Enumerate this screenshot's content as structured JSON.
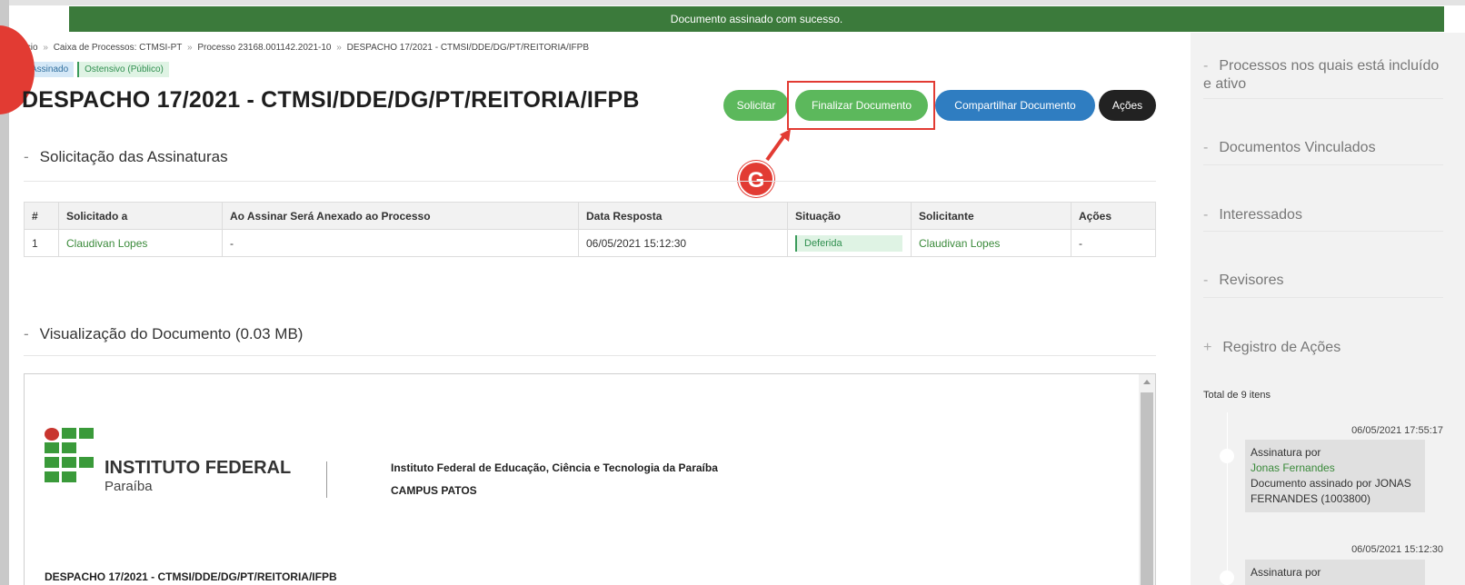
{
  "banner": {
    "message": "Documento assinado com sucesso."
  },
  "breadcrumb": {
    "items": [
      "ício",
      "Caixa de Processos: CTMSI-PT",
      "Processo 23168.001142.2021-10",
      "DESPACHO 17/2021 - CTMSI/DDE/DG/PT/REITORIA/IFPB"
    ],
    "separator": "»"
  },
  "tags": {
    "status": "Assinado",
    "access": "Ostensivo (Público)"
  },
  "page": {
    "title": "DESPACHO 17/2021 - CTMSI/DDE/DG/PT/REITORIA/IFPB"
  },
  "toolbar": {
    "solicitar": "Solicitar",
    "finalizar": "Finalizar Documento",
    "compartilhar": "Compartilhar Documento",
    "acoes": "Ações"
  },
  "annotation": {
    "badge": "G",
    "color": "#e23b33"
  },
  "signatures": {
    "dash": "-",
    "heading": "Solicitação das Assinaturas",
    "columns": [
      "#",
      "Solicitado a",
      "Ao Assinar Será Anexado ao Processo",
      "Data Resposta",
      "Situação",
      "Solicitante",
      "Ações"
    ],
    "rows": [
      {
        "num": "1",
        "solicitado": "Claudivan Lopes",
        "anexado": "-",
        "data": "06/05/2021 15:12:30",
        "situacao": "Deferida",
        "solicitante": "Claudivan Lopes",
        "acoes": "-"
      }
    ]
  },
  "preview": {
    "dash": "-",
    "heading": "Visualização do Documento (0.03 MB)",
    "logo_title": "INSTITUTO FEDERAL",
    "logo_sub": "Paraíba",
    "institution": "Instituto Federal de Educação, Ciência e Tecnologia da Paraíba",
    "campus": "CAMPUS PATOS",
    "doc_title": "DESPACHO 17/2021 - CTMSI/DDE/DG/PT/REITORIA/IFPB"
  },
  "sidebar": {
    "items": [
      {
        "prefix": "-",
        "label": "Processos nos quais está incluído e ativo"
      },
      {
        "prefix": "-",
        "label": "Documentos Vinculados"
      },
      {
        "prefix": "-",
        "label": "Interessados"
      },
      {
        "prefix": "-",
        "label": "Revisores"
      },
      {
        "prefix": "+",
        "label": "Registro de Ações"
      }
    ],
    "total": "Total de 9 itens",
    "timeline": [
      {
        "time": "06/05/2021 17:55:17",
        "action": "Assinatura por",
        "person": "Jonas Fernandes",
        "detail": "Documento assinado por JONAS FERNANDES (1003800)"
      },
      {
        "time": "06/05/2021 15:12:30",
        "action": "Assinatura por"
      }
    ]
  },
  "colors": {
    "brand_green": "#3b7a3b",
    "button_green": "#5cb85c",
    "button_blue": "#2f7dc1",
    "alert_red": "#e23b33"
  }
}
